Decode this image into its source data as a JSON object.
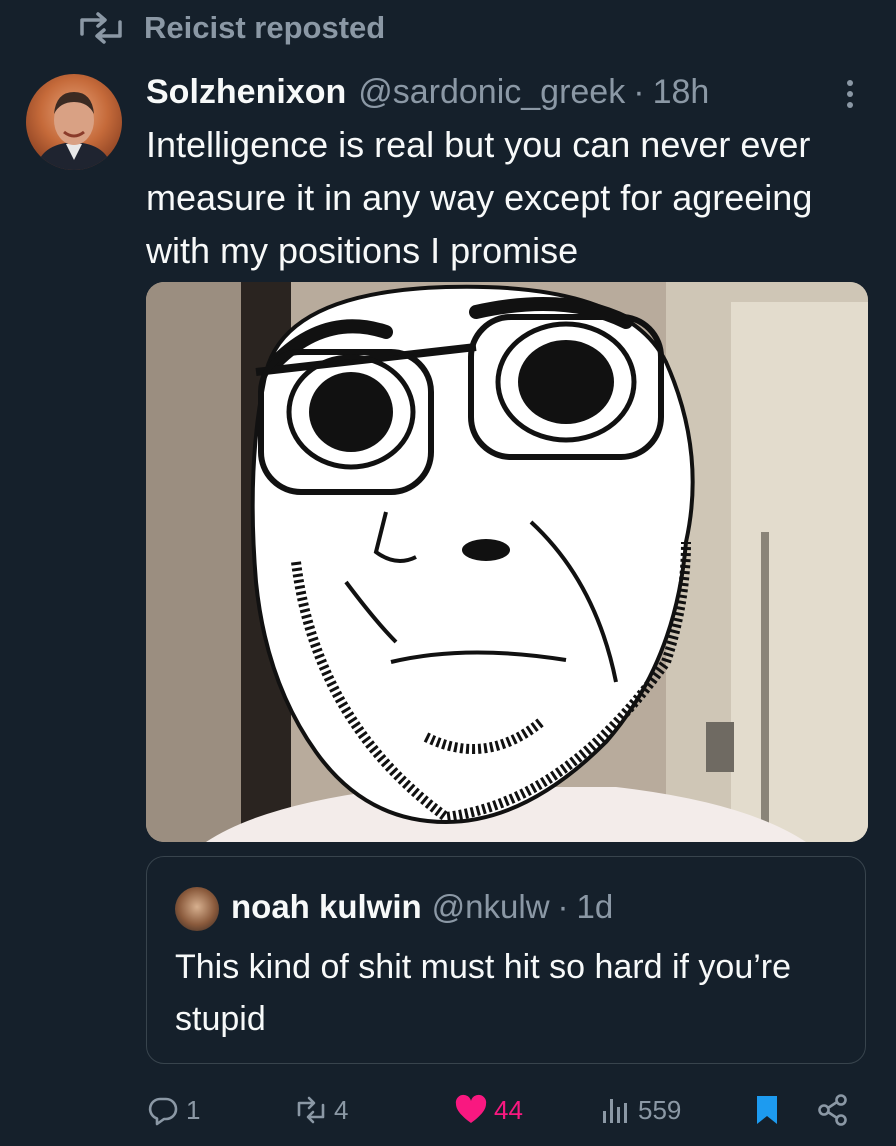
{
  "repost": {
    "text": "Reicist reposted",
    "icon": "repost-icon"
  },
  "tweet": {
    "author_name": "Solzhenixon",
    "handle": "@sardonic_greek",
    "separator": "·",
    "time": "18h",
    "text": "Intelligence is real but you can never ever measure it in any way except for agreeing with my positions I promise",
    "more_icon": "more-icon",
    "media": {
      "description_icon": "wojak-meme-image"
    }
  },
  "quote": {
    "author_name": "noah kulwin",
    "handle": "@nkulw",
    "separator": "·",
    "time": "1d",
    "text": "This kind of shit must hit so hard if you’re stupid"
  },
  "actions": {
    "reply_count": "1",
    "repost_count": "4",
    "like_count": "44",
    "view_count": "559"
  },
  "colors": {
    "background": "#15202b",
    "text": "#f7f9f9",
    "muted": "#8b98a5",
    "like": "#f91880",
    "bookmark": "#1d9bf0",
    "border": "#38444d"
  }
}
